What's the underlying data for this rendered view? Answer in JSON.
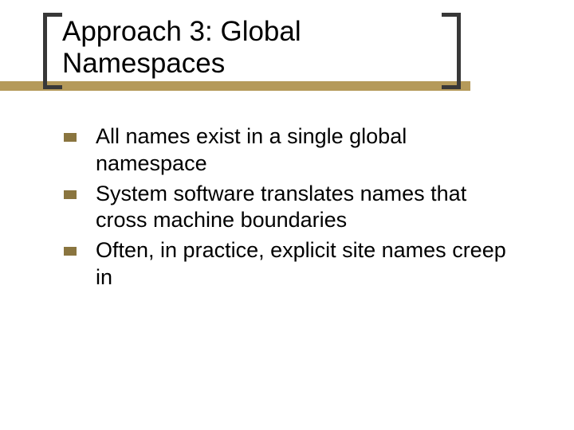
{
  "title": "Approach 3:  Global Namespaces",
  "bullets": [
    "All names exist in a single global namespace",
    "System software translates names that cross machine boundaries",
    "Often, in practice, explicit site names creep in"
  ],
  "colors": {
    "accent_bar": "#b59a5a",
    "bracket": "#383838",
    "bullet": "#8a753f"
  }
}
